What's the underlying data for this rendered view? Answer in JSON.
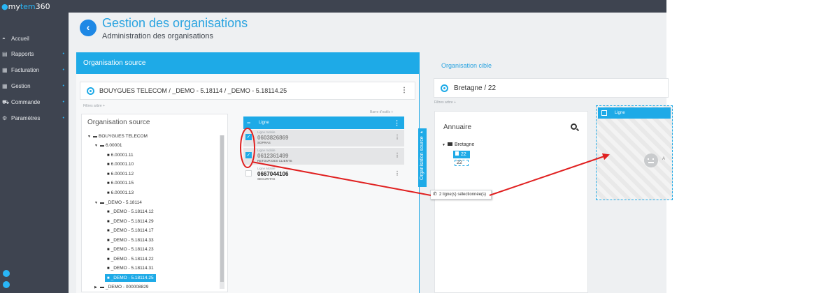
{
  "app": {
    "logo_prefix": "my",
    "logo_accent": "tem",
    "logo_suffix": "360"
  },
  "sidebar": {
    "items": [
      {
        "label": "Accueil",
        "icon": "dashboard-icon",
        "glyph": "◓",
        "has_submenu": false
      },
      {
        "label": "Rapports",
        "icon": "reports-icon",
        "glyph": "▤",
        "has_submenu": true
      },
      {
        "label": "Facturation",
        "icon": "billing-icon",
        "glyph": "▦",
        "has_submenu": true
      },
      {
        "label": "Gestion",
        "icon": "management-icon",
        "glyph": "▦",
        "has_submenu": true
      },
      {
        "label": "Commande",
        "icon": "cart-icon",
        "glyph": "⛟",
        "has_submenu": true
      },
      {
        "label": "Paramètres",
        "icon": "gear-icon",
        "glyph": "⚙",
        "has_submenu": true
      }
    ],
    "caret": "•"
  },
  "header": {
    "title": "Gestion des organisations",
    "subtitle": "Administration des organisations"
  },
  "source": {
    "panel_title": "Organisation source",
    "selector_text": "BOUYGUES TELECOM / _DEMO - 5.18114 / _DEMO - 5.18114.25",
    "filters_link": "Filtres arbre +",
    "toolbar_link": "Barre d'outils +",
    "tree_title": "Organisation source",
    "tree": [
      {
        "label": "BOUYGUES TELECOM",
        "toggle": "▼",
        "icon": "folder-open-icon",
        "glyph": "▬"
      },
      {
        "label": "6.00001",
        "toggle": "▼",
        "icon": "folder-open-icon",
        "glyph": "▬"
      },
      {
        "label": "6.00001.11",
        "toggle": "",
        "icon": "file-icon",
        "glyph": "■"
      },
      {
        "label": "6.00001.10",
        "toggle": "",
        "icon": "file-icon",
        "glyph": "■"
      },
      {
        "label": "6.00001.12",
        "toggle": "",
        "icon": "file-icon",
        "glyph": "■"
      },
      {
        "label": "6.00001.15",
        "toggle": "",
        "icon": "file-icon",
        "glyph": "■"
      },
      {
        "label": "6.00001.13",
        "toggle": "",
        "icon": "file-icon",
        "glyph": "■"
      },
      {
        "label": "_DEMO - 5.18114",
        "toggle": "▼",
        "icon": "folder-open-icon",
        "glyph": "▬"
      },
      {
        "label": "_DEMO - 5.18114.12",
        "toggle": "",
        "icon": "file-icon",
        "glyph": "■"
      },
      {
        "label": "_DEMO - 5.18114.29",
        "toggle": "",
        "icon": "file-icon",
        "glyph": "■"
      },
      {
        "label": "_DEMO - 5.18114.17",
        "toggle": "",
        "icon": "file-icon",
        "glyph": "■"
      },
      {
        "label": "_DEMO - 5.18114.33",
        "toggle": "",
        "icon": "file-icon",
        "glyph": "■"
      },
      {
        "label": "_DEMO - 5.18114.23",
        "toggle": "",
        "icon": "file-icon",
        "glyph": "■"
      },
      {
        "label": "_DEMO - 5.18114.22",
        "toggle": "",
        "icon": "file-icon",
        "glyph": "■"
      },
      {
        "label": "_DEMO - 5.18114.31",
        "toggle": "",
        "icon": "file-icon",
        "glyph": "■"
      },
      {
        "label": "_DEMO - 5.18114.25",
        "toggle": "",
        "icon": "file-icon",
        "glyph": "■",
        "selected": true
      },
      {
        "label": "_DEMO - 000008829",
        "toggle": "▶",
        "icon": "folder-icon",
        "glyph": "▬"
      }
    ],
    "lines": {
      "header_label": "Ligne",
      "header_minus": "−",
      "kebab": "⋮",
      "rows": [
        {
          "sub": "Ligne mobile",
          "number": "0603826869",
          "tag": "SOPRAS",
          "checked": true,
          "check_glyph": "✓"
        },
        {
          "sub": "Ligne mobile",
          "number": "0612361499",
          "tag": "RETOUR DES CLIENTS",
          "checked": true,
          "check_glyph": "✓"
        },
        {
          "sub": "Ligne Mobile",
          "number": "0667044106",
          "tag": "SECURITAS",
          "checked": false,
          "check_glyph": ""
        }
      ]
    },
    "vertical_tab_label": "Organisation source",
    "vertical_tab_arrow": "◂"
  },
  "target": {
    "title": "Organisation cible",
    "selector_text": "Bretagne / 22",
    "filters_link": "Filtres arbre +",
    "annuaire_title": "Annuaire",
    "tree": {
      "root": "Bretagne",
      "root_toggle": "▼",
      "child": "22",
      "ghost": "22"
    },
    "drop_header_label": "Ligne",
    "drop_hint": "A"
  },
  "tooltip": {
    "text": "2 ligne(s) sélectionnée(s)",
    "icon": "phone-icon",
    "glyph": "✆"
  },
  "kebab_glyph": "⋮",
  "back_glyph": "‹",
  "colors": {
    "accent": "#1eaae7",
    "sidebar": "#3e4450",
    "annotation": "#e02020"
  }
}
